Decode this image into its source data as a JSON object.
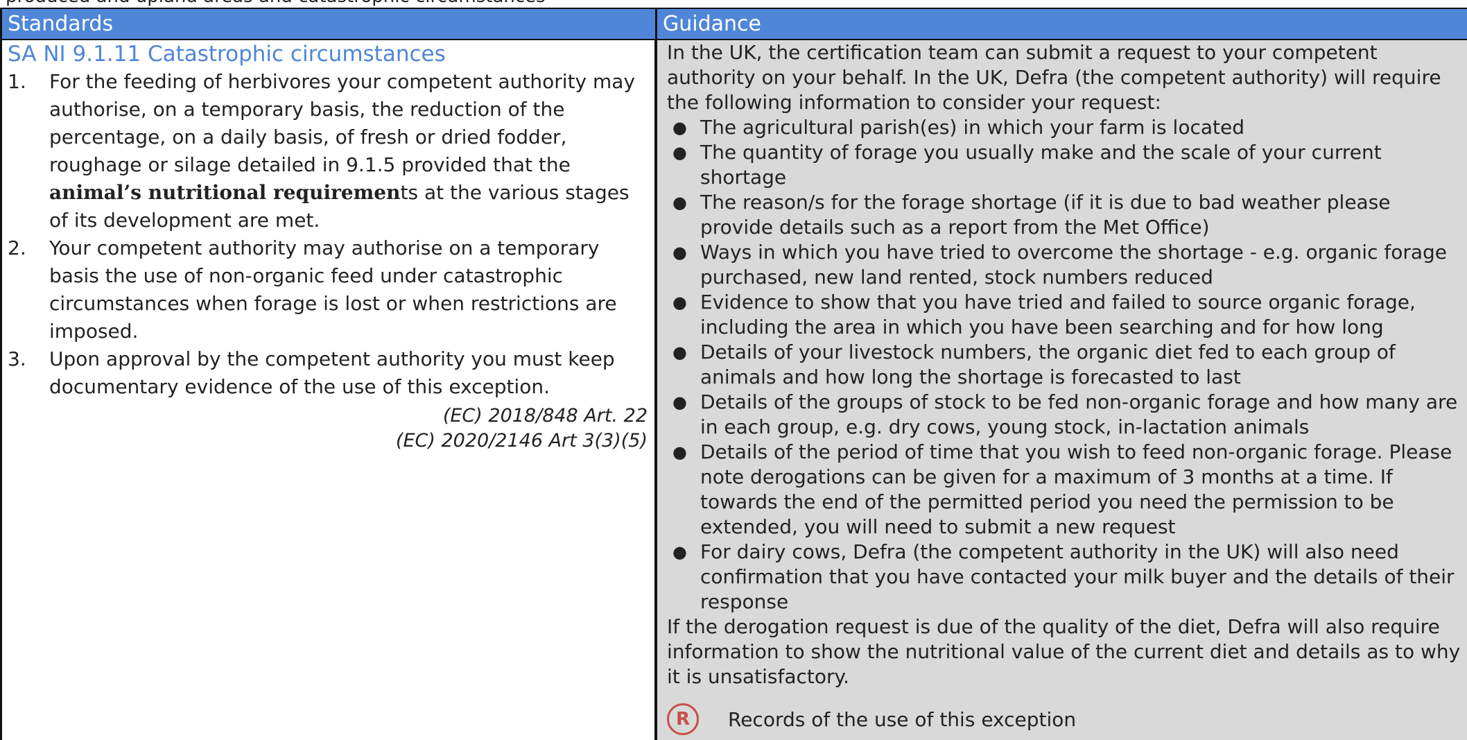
{
  "top_strip": "produced and upland areas and catastrophic circumstances",
  "header": {
    "standards": "Standards",
    "guidance": "Guidance"
  },
  "standards": {
    "title": "SA NI 9.1.11 Catastrophic circumstances",
    "items": [
      {
        "num": "1.",
        "pre": "For the feeding of herbivores your competent authority may authorise, on a temporary basis, the reduction of the percentage, on a daily basis, of fresh or dried fodder, roughage or silage  detailed in 9.1.5 provided that the ",
        "bold": "animal’s nutritional requiremen",
        "post": "ts at the various stages of its development are met."
      },
      {
        "num": "2.",
        "pre": "Your competent authority may authorise on a temporary basis the use of non-organic feed under catastrophic circumstances when forage is lost or when restrictions are imposed.",
        "bold": "",
        "post": ""
      },
      {
        "num": "3.",
        "pre": "Upon approval by the competent authority you must keep documentary evidence of the use of this exception.",
        "bold": "",
        "post": ""
      }
    ],
    "refs": [
      "(EC) 2018/848 Art. 22",
      "(EC) 2020/2146 Art 3(3)(5)"
    ]
  },
  "guidance": {
    "intro": "In the UK, the certification team can submit a request to your competent authority on your behalf.  In the UK, Defra (the competent authority) will require the following information to consider your request:",
    "bullets": [
      "The agricultural parish(es) in which your farm is located",
      "The quantity of forage you usually make and the scale of your current shortage",
      "The reason/s for the forage shortage (if it is due to bad weather please provide details such as a report from the Met Office)",
      "Ways in which you have tried to overcome the shortage - e.g. organic forage purchased, new land rented, stock numbers reduced",
      "Evidence to show that you have tried and failed to source organic forage, including the area in which you have been searching and for how long",
      "Details of your livestock numbers, the organic diet fed to each group of animals and how long the shortage is forecasted to last",
      "Details of the groups of stock to be fed non-organic forage and how many are in each group, e.g. dry cows, young stock, in-lactation animals",
      "Details of the period of time that you wish to feed non-organic forage.  Please note derogations can be given for a maximum of 3 months at a time.  If towards the end of the permitted period you need the permission to be extended, you will need to submit a new request",
      "For dairy cows, Defra (the competent authority in the UK) will also need confirmation that you have contacted your milk buyer and the details of their response"
    ],
    "closing": "If the derogation request is due of the quality of the diet, Defra will also require information to show the nutritional value of the current diet and details as to why it is unsatisfactory.",
    "records_icon": "R",
    "records_text": "Records of the use of this exception"
  }
}
